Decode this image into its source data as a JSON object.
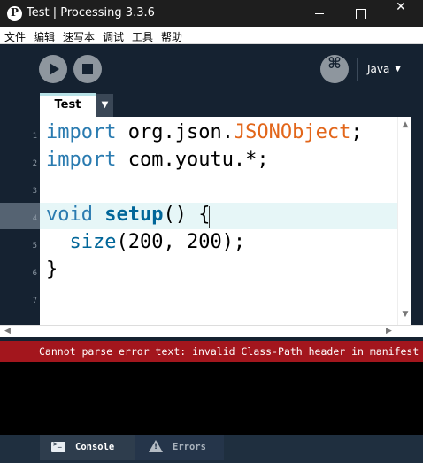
{
  "window": {
    "title": "Test | Processing 3.3.6",
    "minimize_glyph": "",
    "maximize_glyph": "",
    "close_glyph": "✕"
  },
  "menu": [
    "文件",
    "编辑",
    "速写本",
    "调试",
    "工具",
    "帮助"
  ],
  "toolbar": {
    "run_icon": "play-icon",
    "stop_icon": "stop-icon",
    "debug_glyph": "⌘",
    "mode_label": "Java",
    "mode_caret": "▼"
  },
  "tabs": {
    "active_tab": "Test",
    "menu_glyph": "▼"
  },
  "editor": {
    "line_numbers": [
      "1",
      "2",
      "3",
      "4",
      "5",
      "6",
      "7"
    ],
    "lines": {
      "l1_kw": "import",
      "l1_pkg": " org.json.",
      "l1_cls": "JSONObject",
      "l1_end": ";",
      "l2_kw": "import",
      "l2_rest": " com.youtu.*;",
      "l4_kw": "void",
      "l4_sp": " ",
      "l4_fn": "setup",
      "l4_rest": "() {",
      "l5_indent": "  ",
      "l5_fn": "size",
      "l5_rest": "(200, 200);",
      "l6": "}"
    },
    "highlighted_line": 4
  },
  "scrollbars": {
    "up": "▲",
    "down": "▼",
    "left": "◀",
    "right": "▶"
  },
  "status": {
    "error_message": "Cannot parse error text: invalid Class-Path header in manifest"
  },
  "footer": {
    "console_label": "Console",
    "errors_label": "Errors"
  },
  "colors": {
    "editor_bg": "#ffffff",
    "chrome_bg": "#152231",
    "error_bar": "#a3161d",
    "keyword": "#2a7bb0",
    "class_name": "#e2661a",
    "function": "#006699"
  }
}
